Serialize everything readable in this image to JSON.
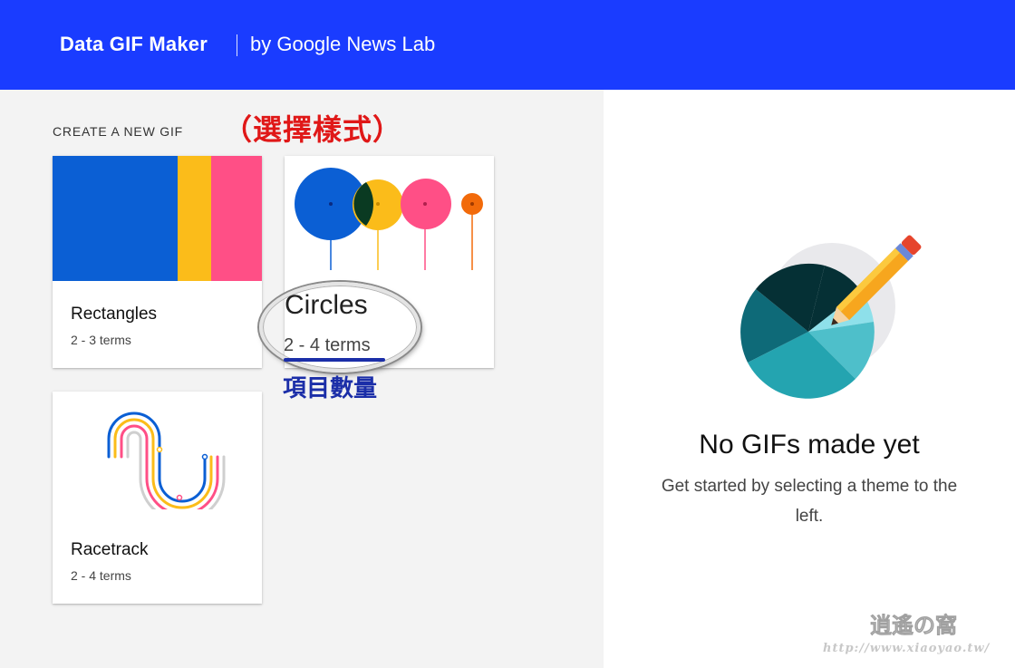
{
  "header": {
    "app_title": "Data GIF Maker",
    "byline": "by Google News Lab",
    "background": "#1a3cff"
  },
  "create": {
    "section_label": "CREATE A NEW GIF",
    "annotation_style": "（選擇樣式）",
    "annotation_count": "項目數量",
    "cards": [
      {
        "title": "Rectangles",
        "terms": "2 - 3 terms"
      },
      {
        "title": "Circles",
        "terms": "2 - 4 terms"
      },
      {
        "title": "Racetrack",
        "terms": "2 - 4 terms"
      }
    ]
  },
  "empty_state": {
    "title": "No GIFs made yet",
    "description": "Get started by selecting a theme to the left.",
    "icon": "pie-chart-pencil-icon"
  },
  "watermark": {
    "url": "http://www.xiaoyao.tw/"
  },
  "colors": {
    "blue": "#0b5fd4",
    "yellow": "#fbbc1a",
    "pink": "#ff4f86",
    "orange": "#f26a0a",
    "annotation_red": "#e01818",
    "annotation_blue": "#1b2ea8"
  }
}
